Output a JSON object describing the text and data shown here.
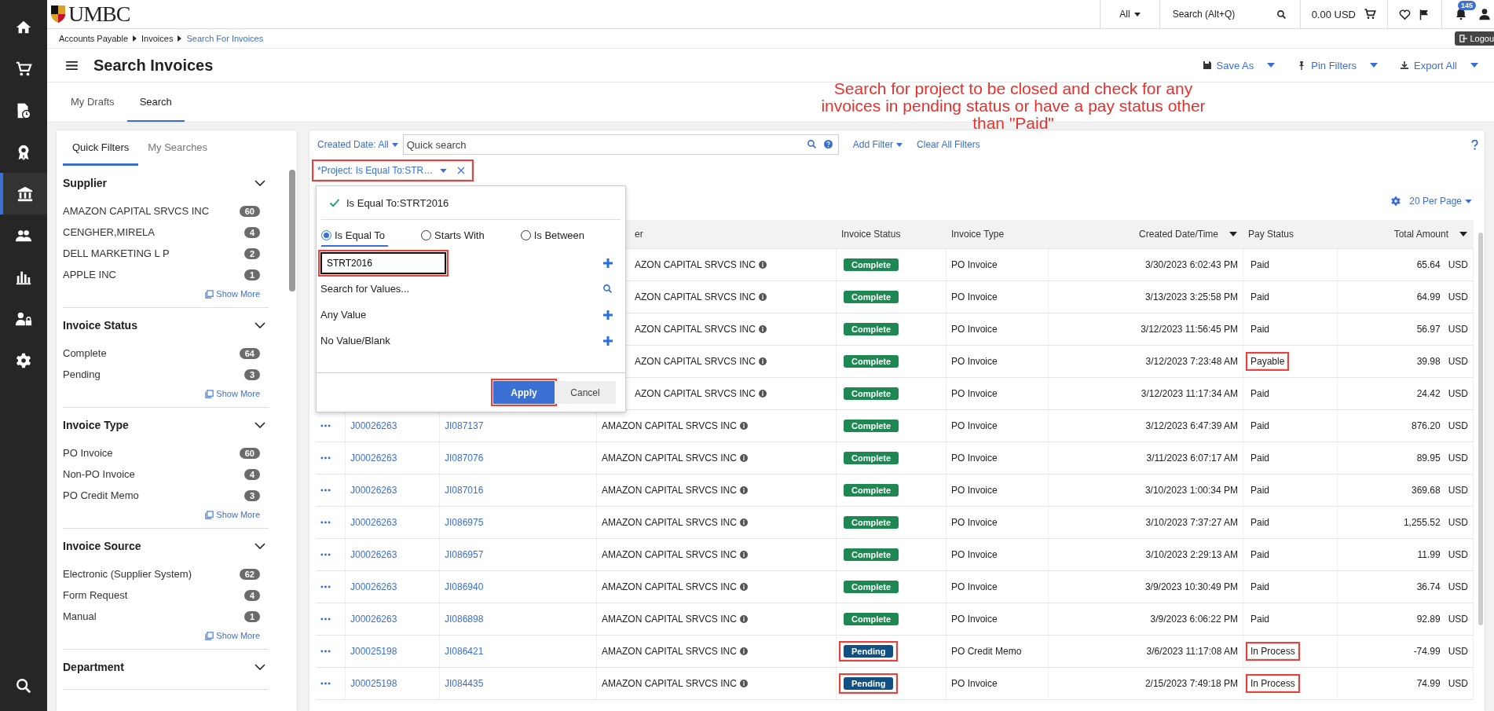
{
  "nav_icons": [
    {
      "kind": "home",
      "selected": false
    },
    {
      "kind": "cart",
      "selected": false
    },
    {
      "kind": "document",
      "selected": false
    },
    {
      "kind": "award",
      "selected": false
    },
    {
      "kind": "bank",
      "selected": true
    },
    {
      "kind": "people",
      "selected": false
    },
    {
      "kind": "chart",
      "selected": false
    },
    {
      "kind": "lock",
      "selected": false
    },
    {
      "kind": "gear",
      "selected": false
    },
    {
      "kind": "search",
      "selected": false
    }
  ],
  "logo": {
    "text": "UMBC"
  },
  "top_bar": {
    "scope": "All",
    "search_placeholder": "Search (Alt+Q)",
    "cart_total": "0.00 USD",
    "notification_count": "145",
    "logout": "Logou"
  },
  "breadcrumb": [
    {
      "label": "Accounts Payable",
      "current": false
    },
    {
      "label": "Invoices",
      "current": false
    },
    {
      "label": "Search For Invoices",
      "current": true
    }
  ],
  "page_title": "Search Invoices",
  "actions": [
    {
      "label": "Save As",
      "kind": "save"
    },
    {
      "label": "Pin Filters",
      "kind": "pin"
    },
    {
      "label": "Export All",
      "kind": "export"
    }
  ],
  "tabs": [
    {
      "label": "My Drafts",
      "selected": false
    },
    {
      "label": "Search",
      "selected": true
    }
  ],
  "annotation": {
    "lines": [
      "Search for project to be closed and check for any",
      "invoices in pending status or have a pay status other",
      "than \"Paid\""
    ]
  },
  "filter_panel": {
    "tabs": [
      {
        "label": "Quick Filters",
        "selected": true
      },
      {
        "label": "My Searches",
        "selected": false
      }
    ],
    "sections": [
      {
        "title": "Supplier",
        "expanded": true,
        "items": [
          {
            "label": "AMAZON CAPITAL SRVCS INC",
            "count": "60"
          },
          {
            "label": "CENGHER,MIRELA",
            "count": "4"
          },
          {
            "label": "DELL MARKETING L P",
            "count": "2"
          },
          {
            "label": "APPLE INC",
            "count": "1"
          }
        ],
        "show_more": "Show More"
      },
      {
        "title": "Invoice Status",
        "expanded": true,
        "items": [
          {
            "label": "Complete",
            "count": "64"
          },
          {
            "label": "Pending",
            "count": "3"
          }
        ],
        "show_more": "Show More"
      },
      {
        "title": "Invoice Type",
        "expanded": true,
        "items": [
          {
            "label": "PO Invoice",
            "count": "60"
          },
          {
            "label": "Non-PO Invoice",
            "count": "4"
          },
          {
            "label": "PO Credit Memo",
            "count": "3"
          }
        ],
        "show_more": "Show More"
      },
      {
        "title": "Invoice Source",
        "expanded": true,
        "items": [
          {
            "label": "Electronic (Supplier System)",
            "count": "62"
          },
          {
            "label": "Form Request",
            "count": "4"
          },
          {
            "label": "Manual",
            "count": "1"
          }
        ],
        "show_more": "Show More"
      },
      {
        "title": "Department",
        "expanded": true
      }
    ]
  },
  "search_bar": {
    "date_filter": "Created Date: All",
    "placeholder": "Quick search",
    "add_filter": "Add Filter",
    "clear_all": "Clear All Filters"
  },
  "filter_chip": {
    "label": "*Project: Is Equal To:STR…",
    "marked": true
  },
  "filter_popup": {
    "summary": "Is Equal To:STRT2016",
    "options": [
      {
        "label": "Is Equal To",
        "selected": true
      },
      {
        "label": "Starts With",
        "selected": false
      },
      {
        "label": "Is Between",
        "selected": false
      }
    ],
    "value": "STRT2016",
    "value_marked": true,
    "choices": [
      {
        "label": "Search for Values...",
        "kind": "search"
      },
      {
        "label": "Any Value",
        "kind": "add"
      },
      {
        "label": "No Value/Blank",
        "kind": "add"
      }
    ],
    "apply": "Apply",
    "apply_marked": true,
    "cancel": "Cancel"
  },
  "per_page": "20 Per Page",
  "table": {
    "columns": [
      {
        "label": "er",
        "sorted": false
      },
      {
        "label": "Invoice Status",
        "sorted": false
      },
      {
        "label": "Invoice Type",
        "sorted": false
      },
      {
        "label": "Created Date/Time",
        "sorted": true
      },
      {
        "label": "Pay Status",
        "sorted": false
      },
      {
        "label": "Total Amount",
        "sorted": true
      }
    ],
    "rows": [
      {
        "supplier": "AZON CAPITAL SRVCS INC",
        "status": {
          "text": "Complete",
          "kind": "complete",
          "marked": false
        },
        "type": "PO Invoice",
        "created": "3/30/2023 6:02:43 PM",
        "pay_status": "Paid",
        "pay_marked": false,
        "amount": "65.64",
        "currency": "USD"
      },
      {
        "supplier": "AZON CAPITAL SRVCS INC",
        "status": {
          "text": "Complete",
          "kind": "complete",
          "marked": false
        },
        "type": "PO Invoice",
        "created": "3/13/2023 3:25:58 PM",
        "pay_status": "Paid",
        "pay_marked": false,
        "amount": "64.99",
        "currency": "USD"
      },
      {
        "supplier": "AZON CAPITAL SRVCS INC",
        "status": {
          "text": "Complete",
          "kind": "complete",
          "marked": false
        },
        "type": "PO Invoice",
        "created": "3/12/2023 11:56:45 PM",
        "pay_status": "Paid",
        "pay_marked": false,
        "amount": "56.97",
        "currency": "USD"
      },
      {
        "supplier": "AZON CAPITAL SRVCS INC",
        "status": {
          "text": "Complete",
          "kind": "complete",
          "marked": false
        },
        "type": "PO Invoice",
        "created": "3/12/2023 7:23:48 AM",
        "pay_status": "Payable",
        "pay_marked": true,
        "amount": "39.98",
        "currency": "USD"
      },
      {
        "supplier": "AZON CAPITAL SRVCS INC",
        "status": {
          "text": "Complete",
          "kind": "complete",
          "marked": false
        },
        "type": "PO Invoice",
        "created": "3/12/2023 11:17:34 AM",
        "pay_status": "Paid",
        "pay_marked": false,
        "amount": "24.42",
        "currency": "USD"
      },
      {
        "invoice_no": "J00026263",
        "supplier_invoice": "JI087137",
        "supplier": "AMAZON CAPITAL SRVCS INC",
        "status": {
          "text": "Complete",
          "kind": "complete",
          "marked": false
        },
        "type": "PO Invoice",
        "created": "3/12/2023 6:47:39 AM",
        "pay_status": "Paid",
        "pay_marked": false,
        "amount": "876.20",
        "currency": "USD"
      },
      {
        "invoice_no": "J00026263",
        "supplier_invoice": "JI087076",
        "supplier": "AMAZON CAPITAL SRVCS INC",
        "status": {
          "text": "Complete",
          "kind": "complete",
          "marked": false
        },
        "type": "PO Invoice",
        "created": "3/11/2023 6:07:17 AM",
        "pay_status": "Paid",
        "pay_marked": false,
        "amount": "89.95",
        "currency": "USD"
      },
      {
        "invoice_no": "J00026263",
        "supplier_invoice": "JI087016",
        "supplier": "AMAZON CAPITAL SRVCS INC",
        "status": {
          "text": "Complete",
          "kind": "complete",
          "marked": false
        },
        "type": "PO Invoice",
        "created": "3/10/2023 1:00:34 PM",
        "pay_status": "Paid",
        "pay_marked": false,
        "amount": "369.68",
        "currency": "USD"
      },
      {
        "invoice_no": "J00026263",
        "supplier_invoice": "JI086975",
        "supplier": "AMAZON CAPITAL SRVCS INC",
        "status": {
          "text": "Complete",
          "kind": "complete",
          "marked": false
        },
        "type": "PO Invoice",
        "created": "3/10/2023 7:37:27 AM",
        "pay_status": "Paid",
        "pay_marked": false,
        "amount": "1,255.52",
        "currency": "USD"
      },
      {
        "invoice_no": "J00026263",
        "supplier_invoice": "JI086957",
        "supplier": "AMAZON CAPITAL SRVCS INC",
        "status": {
          "text": "Complete",
          "kind": "complete",
          "marked": false
        },
        "type": "PO Invoice",
        "created": "3/10/2023 2:29:13 AM",
        "pay_status": "Paid",
        "pay_marked": false,
        "amount": "11.99",
        "currency": "USD"
      },
      {
        "invoice_no": "J00026263",
        "supplier_invoice": "JI086940",
        "supplier": "AMAZON CAPITAL SRVCS INC",
        "status": {
          "text": "Complete",
          "kind": "complete",
          "marked": false
        },
        "type": "PO Invoice",
        "created": "3/9/2023 10:30:49 PM",
        "pay_status": "Paid",
        "pay_marked": false,
        "amount": "36.74",
        "currency": "USD"
      },
      {
        "invoice_no": "J00026263",
        "supplier_invoice": "JI086898",
        "supplier": "AMAZON CAPITAL SRVCS INC",
        "status": {
          "text": "Complete",
          "kind": "complete",
          "marked": false
        },
        "type": "PO Invoice",
        "created": "3/9/2023 6:06:22 PM",
        "pay_status": "Paid",
        "pay_marked": false,
        "amount": "92.89",
        "currency": "USD"
      },
      {
        "invoice_no": "J00025198",
        "supplier_invoice": "JI086421",
        "supplier": "AMAZON CAPITAL SRVCS INC",
        "status": {
          "text": "Pending",
          "kind": "pending",
          "marked": true
        },
        "type": "PO Credit Memo",
        "created": "3/6/2023 11:17:08 AM",
        "pay_status": "In Process",
        "pay_marked": true,
        "amount": "-74.99",
        "currency": "USD"
      },
      {
        "invoice_no": "J00025198",
        "supplier_invoice": "JI084435",
        "supplier": "AMAZON CAPITAL SRVCS INC",
        "status": {
          "text": "Pending",
          "kind": "pending",
          "marked": true
        },
        "type": "PO Invoice",
        "created": "2/15/2023 7:49:18 PM",
        "pay_status": "In Process",
        "pay_marked": true,
        "amount": "74.99",
        "currency": "USD"
      }
    ]
  }
}
